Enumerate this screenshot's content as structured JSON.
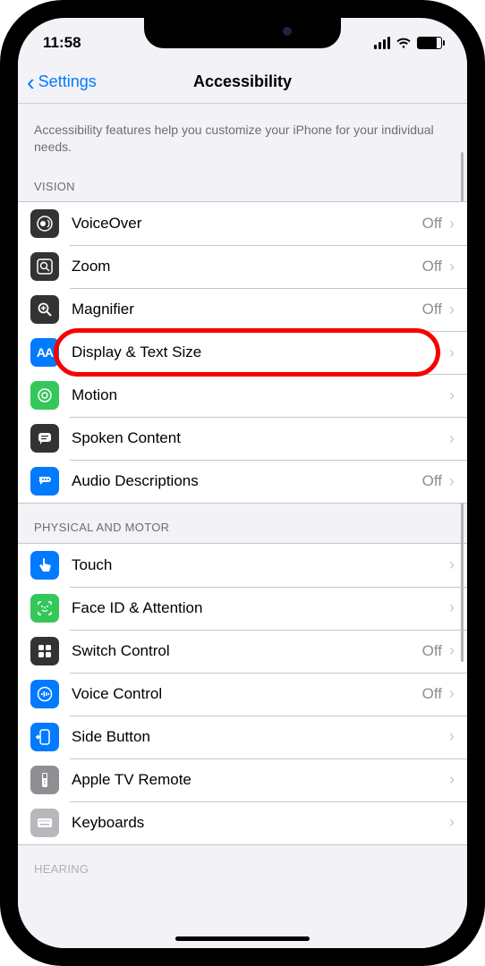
{
  "statusBar": {
    "time": "11:58"
  },
  "nav": {
    "back": "Settings",
    "title": "Accessibility"
  },
  "intro": "Accessibility features help you customize your iPhone for your individual needs.",
  "sections": {
    "vision": {
      "header": "VISION",
      "items": [
        {
          "label": "VoiceOver",
          "detail": "Off"
        },
        {
          "label": "Zoom",
          "detail": "Off"
        },
        {
          "label": "Magnifier",
          "detail": "Off"
        },
        {
          "label": "Display & Text Size",
          "detail": ""
        },
        {
          "label": "Motion",
          "detail": ""
        },
        {
          "label": "Spoken Content",
          "detail": ""
        },
        {
          "label": "Audio Descriptions",
          "detail": "Off"
        }
      ]
    },
    "physical": {
      "header": "PHYSICAL AND MOTOR",
      "items": [
        {
          "label": "Touch",
          "detail": ""
        },
        {
          "label": "Face ID & Attention",
          "detail": ""
        },
        {
          "label": "Switch Control",
          "detail": "Off"
        },
        {
          "label": "Voice Control",
          "detail": "Off"
        },
        {
          "label": "Side Button",
          "detail": ""
        },
        {
          "label": "Apple TV Remote",
          "detail": ""
        },
        {
          "label": "Keyboards",
          "detail": ""
        }
      ]
    },
    "hearing": {
      "header": "HEARING"
    }
  },
  "highlighted_row_index": 3
}
